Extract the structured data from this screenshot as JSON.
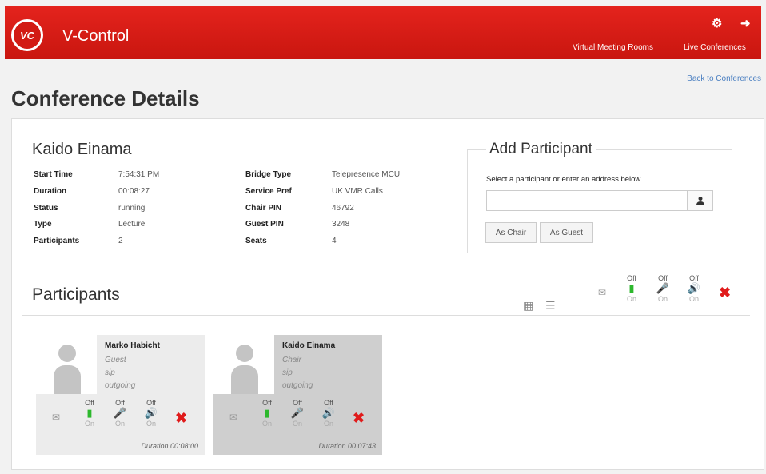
{
  "header": {
    "logo_text": "VC",
    "app_title": "V-Control",
    "settings_icon": "gear-icon",
    "logout_icon": "logout-icon",
    "nav": [
      "Virtual Meeting Rooms",
      "Live Conferences"
    ]
  },
  "back_link": "Back to Conferences",
  "page_title": "Conference Details",
  "conference": {
    "host": "Kaido Einama",
    "left": [
      {
        "key": "Start Time",
        "value": "7:54:31 PM"
      },
      {
        "key": "Duration",
        "value": "00:08:27"
      },
      {
        "key": "Status",
        "value": "running"
      },
      {
        "key": "Type",
        "value": "Lecture"
      },
      {
        "key": "Participants",
        "value": "2"
      }
    ],
    "right": [
      {
        "key": "Bridge Type",
        "value": "Telepresence MCU"
      },
      {
        "key": "Service Pref",
        "value": "UK VMR Calls"
      },
      {
        "key": "Chair PIN",
        "value": "46792"
      },
      {
        "key": "Guest PIN",
        "value": "3248"
      },
      {
        "key": "Seats",
        "value": "4"
      }
    ]
  },
  "add_participant": {
    "title": "Add Participant",
    "hint": "Select a participant or enter an address below.",
    "input_value": "",
    "as_chair": "As Chair",
    "as_guest": "As Guest"
  },
  "participants_title": "Participants",
  "controls": {
    "off": "Off",
    "on": "On"
  },
  "participants": [
    {
      "name": "Marko Habicht",
      "role": "Guest",
      "protocol": "sip",
      "direction": "outgoing",
      "duration": "Duration 00:08:00"
    },
    {
      "name": "Kaido Einama",
      "role": "Chair",
      "protocol": "sip",
      "direction": "outgoing",
      "duration": "Duration 00:07:43"
    }
  ],
  "colors": {
    "brand": "#d21b14",
    "active_green": "#2db82d",
    "remove_red": "#e01b1b",
    "link": "#4a7fc1"
  }
}
